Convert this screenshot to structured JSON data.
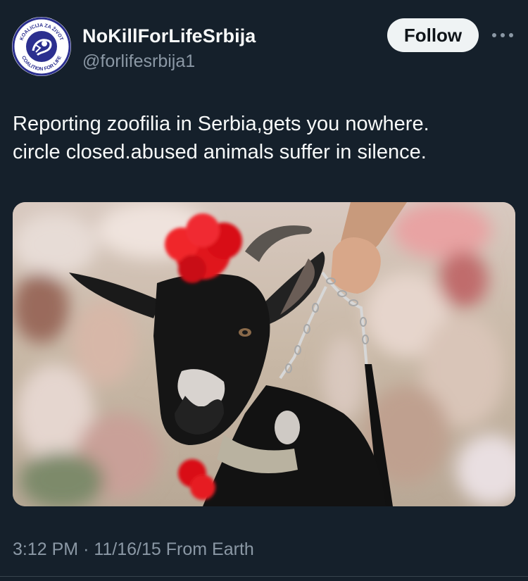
{
  "tweet": {
    "author": {
      "display_name": "NoKillForLifeSrbija",
      "handle": "@forlifesrbija1",
      "avatar_text_top": "KOALICIJA ZA ŽIVOT",
      "avatar_text_bottom": "COALITION FOR LIFE"
    },
    "follow_label": "Follow",
    "more_icon": "more-horizontal-icon",
    "text": "Reporting  zoofilia in Serbia,gets you nowhere.\ncircle closed.abused animals suffer in silence.",
    "media": {
      "description_icon": "photo-goat-on-chain-leash"
    },
    "time": "3:12 PM",
    "separator": "·",
    "date": "11/16/15",
    "source": "From Earth"
  },
  "colors": {
    "background": "#15202b",
    "text_primary": "#f7f9f9",
    "text_secondary": "#8b98a5",
    "follow_bg": "#eff3f4",
    "avatar_accent": "#2b2f8f"
  }
}
